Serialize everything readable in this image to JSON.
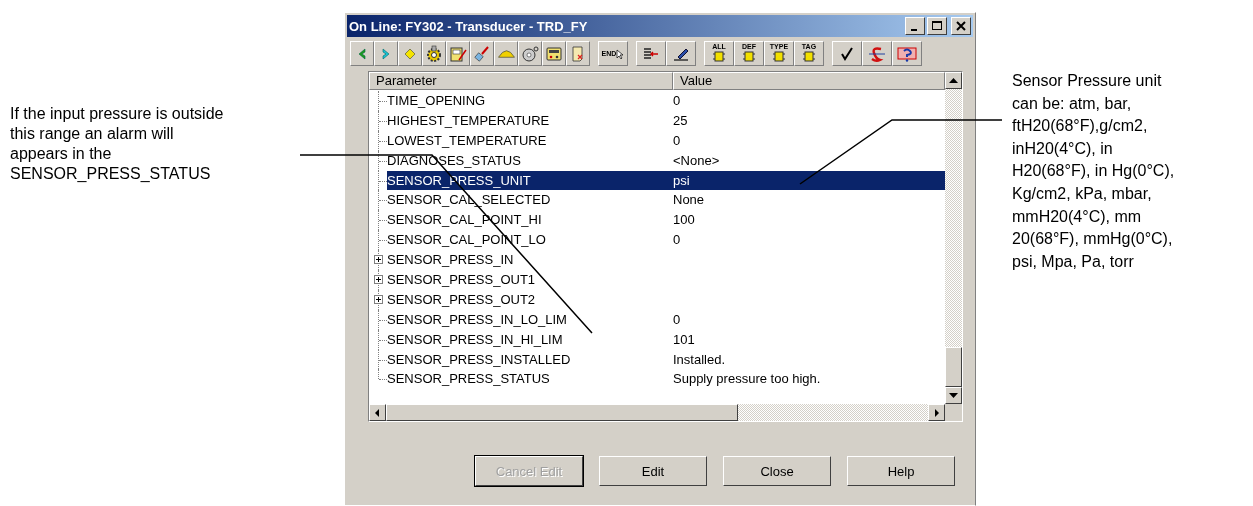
{
  "left_note": {
    "lines": [
      "If the input pressure is outside",
      "this range an alarm will",
      "appears in the",
      "SENSOR_PRESS_STATUS"
    ]
  },
  "window": {
    "title": "On Line: FY302 - Transducer - TRD_FY"
  },
  "toolbar_groups": [
    [
      {
        "kind": "back"
      },
      {
        "kind": "forward"
      },
      {
        "kind": "diamond"
      },
      {
        "kind": "gear"
      },
      {
        "kind": "meter"
      },
      {
        "kind": "probe"
      },
      {
        "kind": "dome"
      },
      {
        "kind": "disc"
      },
      {
        "kind": "device"
      },
      {
        "kind": "scroll"
      }
    ],
    [
      {
        "kind": "label",
        "label": "END"
      }
    ],
    [
      {
        "kind": "list"
      },
      {
        "kind": "pen"
      }
    ],
    [
      {
        "kind": "chip",
        "label": "ALL"
      },
      {
        "kind": "chip",
        "label": "DEF"
      },
      {
        "kind": "chip",
        "label": "TYPE"
      },
      {
        "kind": "chip",
        "label": "TAG"
      }
    ],
    [
      {
        "kind": "check"
      },
      {
        "kind": "strike"
      },
      {
        "kind": "help"
      }
    ]
  ],
  "table": {
    "columns": [
      "Parameter",
      "Value"
    ],
    "rows": [
      {
        "name": "TIME_OPENING",
        "value": "0",
        "kind": "leaf",
        "selected": false
      },
      {
        "name": "HIGHEST_TEMPERATURE",
        "value": "25",
        "kind": "leaf",
        "selected": false
      },
      {
        "name": "LOWEST_TEMPERATURE",
        "value": "0",
        "kind": "leaf",
        "selected": false
      },
      {
        "name": "DIAGNOSES_STATUS",
        "value": "<None>",
        "kind": "leaf",
        "selected": false
      },
      {
        "name": "SENSOR_PRESS_UNIT",
        "value": "psi",
        "kind": "leaf",
        "selected": true
      },
      {
        "name": "SENSOR_CAL_SELECTED",
        "value": "None",
        "kind": "leaf",
        "selected": false
      },
      {
        "name": "SENSOR_CAL_POINT_HI",
        "value": "100",
        "kind": "leaf",
        "selected": false
      },
      {
        "name": "SENSOR_CAL_POINT_LO",
        "value": "0",
        "kind": "leaf",
        "selected": false
      },
      {
        "name": "SENSOR_PRESS_IN",
        "kind": "group",
        "selected": false
      },
      {
        "name": "SENSOR_PRESS_OUT1",
        "kind": "group",
        "selected": false
      },
      {
        "name": "SENSOR_PRESS_OUT2",
        "kind": "group",
        "selected": false
      },
      {
        "name": "SENSOR_PRESS_IN_LO_LIM",
        "value": "0",
        "kind": "leaf",
        "selected": false
      },
      {
        "name": "SENSOR_PRESS_IN_HI_LIM",
        "value": "101",
        "kind": "leaf",
        "selected": false
      },
      {
        "name": "SENSOR_PRESS_INSTALLED",
        "value": "Installed.",
        "kind": "leaf",
        "selected": false
      },
      {
        "name": "SENSOR_PRESS_STATUS",
        "value": "Supply pressure too high.",
        "kind": "leaf",
        "selected": false
      }
    ]
  },
  "buttons": [
    {
      "label": "Cancel Edit",
      "disabled": true,
      "default": true
    },
    {
      "label": "Edit",
      "disabled": false,
      "default": false
    },
    {
      "label": "Close",
      "disabled": false,
      "default": false
    },
    {
      "label": "Help",
      "disabled": false,
      "default": false
    }
  ],
  "right_note": {
    "lines": [
      "Sensor Pressure unit",
      "can be: atm, bar,",
      "ftH20(68°F),g/cm2,",
      "inH20(4°C), in",
      "H20(68°F), in Hg(0°C),",
      "Kg/cm2, kPa, mbar,",
      "mmH20(4°C), mm",
      "20(68°F), mmHg(0°C),",
      "psi, Mpa, Pa, torr"
    ]
  }
}
